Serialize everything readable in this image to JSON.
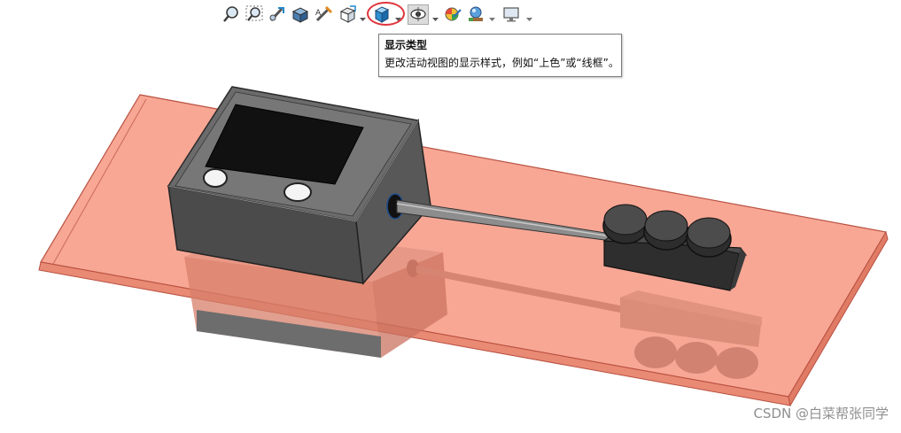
{
  "toolbar": {
    "buttons": [
      {
        "name": "zoom-to-fit",
        "icon": "magnifier-fit-icon"
      },
      {
        "name": "zoom-to-area",
        "icon": "magnifier-area-icon"
      },
      {
        "name": "previous-view",
        "icon": "previous-view-icon"
      },
      {
        "name": "section-view",
        "icon": "section-view-icon"
      },
      {
        "name": "dynamic-annotation-views",
        "icon": "annotation-view-icon"
      },
      {
        "name": "view-orientation",
        "icon": "view-orientation-cube-icon"
      },
      {
        "name": "display-style",
        "icon": "display-style-shaded-icon",
        "highlighted": true
      },
      {
        "name": "hide-show-items",
        "icon": "eye-icon"
      },
      {
        "name": "edit-appearance",
        "icon": "appearance-sphere-icon"
      },
      {
        "name": "apply-scene",
        "icon": "scene-icon"
      },
      {
        "name": "view-settings",
        "icon": "monitor-icon"
      }
    ]
  },
  "tooltip": {
    "title": "显示类型",
    "description": "更改活动视图的显示样式，例如“上色”或“线框”。"
  },
  "watermark": "CSDN @白菜帮张同学",
  "colors": {
    "highlight_ring": "#e0343c",
    "plate_fill": "#f7a08c",
    "plate_edge": "#c0503c",
    "body_gray": "#5a5a5a",
    "accent_blue": "#1e88c8"
  }
}
